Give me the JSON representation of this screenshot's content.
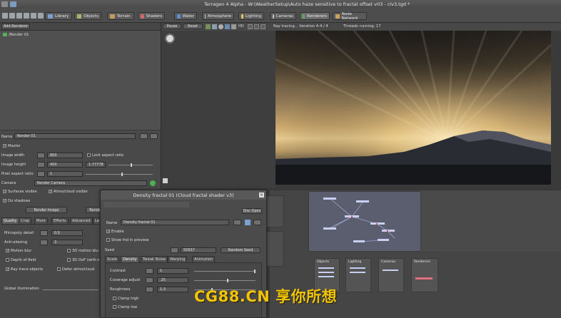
{
  "window": {
    "title": "Terragen 4 Alpha - W:\\WeatherSetup\\Auto haze sensitive to fractal offset v03 - clv3.tgd *"
  },
  "toolbar": {
    "tabs": [
      {
        "label": "Library",
        "color": "#7a9fd0"
      },
      {
        "label": "Objects",
        "color": "#b0b06a"
      },
      {
        "label": "Terrain",
        "color": "#c59a5a"
      },
      {
        "label": "Shaders",
        "color": "#d06a6a"
      },
      {
        "label": "Water",
        "color": "#5a8ed0"
      },
      {
        "label": "Atmosphere",
        "color": "#9ad0e0"
      },
      {
        "label": "Lighting",
        "color": "#e0c860"
      },
      {
        "label": "Cameras",
        "color": "#c0c0c0"
      },
      {
        "label": "Renderers",
        "color": "#5ab05a"
      },
      {
        "label": "Node Network",
        "color": "#d0a05a"
      }
    ]
  },
  "renderer_list": {
    "add_button": "Add Renderer",
    "items": [
      "/Render 01"
    ]
  },
  "render_controls": {
    "pause": "Pause",
    "reset": "Reset",
    "hd": "HD",
    "status": "Ray tracing... iteration 4-4 / 4",
    "threads": "Threads running: 17"
  },
  "renderer_panel": {
    "name_label": "Name",
    "name_value": "Render 01",
    "master_label": "Master",
    "image_width_label": "Image width",
    "image_width_value": "800",
    "lock_aspect_label": "Lock aspect ratio",
    "image_height_label": "Image height",
    "image_height_value": "450",
    "aspect_value": "1.77778",
    "pixel_aspect_label": "Pixel aspect ratio",
    "pixel_aspect_value": "1",
    "camera_label": "Camera",
    "camera_value": "Render Camera",
    "surfaces_visible": "Surfaces visible",
    "atmo_visible": "Atmo/cloud visible",
    "do_shadows": "Do shadows",
    "render_image": "Render Image",
    "render_crop": "Rende",
    "tabs": [
      "Quality",
      "Crop",
      "More",
      "Effects",
      "Advanced",
      "Le"
    ],
    "micropoly_label": "Micropoly detail",
    "micropoly_value": "0.5",
    "anti_alias_label": "Anti-aliasing",
    "anti_alias_value": "3",
    "motion_blur": "Motion blur",
    "depth_of_field": "Depth of field",
    "ray_trace": "Ray trace objects",
    "motion_blur_3d": "3D motion blu",
    "dof_3d": "3D DoF (with m",
    "defer_atmo": "Defer atmo/cloud",
    "gi_label": "Global illumination"
  },
  "dialog": {
    "title": "Density fractal 01   (Cloud fractal shader v3)",
    "disk_button": "Disc Open",
    "enable": "Enable",
    "show_preview": "Show fnd in preview",
    "name_label": "Name",
    "name_value": "Density fractal 01",
    "seed_label": "Seed",
    "seed_value": "55637",
    "random_seed": "Random Seed",
    "tabs": [
      "Scale",
      "Density",
      "Tweak Noise",
      "Warping",
      "Animation"
    ],
    "contrast_label": "Contrast",
    "contrast_value": "1",
    "coverage_label": "Coverage adjust",
    "coverage_value": ".25",
    "roughness_label": "Roughness",
    "roughness_value": "1.3",
    "clamp_high": "Clamp high",
    "clamp_low": "Clamp low"
  },
  "node_network": {
    "groups": [
      {
        "label": "Objects"
      },
      {
        "label": "Lighting"
      },
      {
        "label": "Cameras"
      },
      {
        "label": "Renderers"
      }
    ]
  },
  "watermark": "CG88.CN 享你所想"
}
